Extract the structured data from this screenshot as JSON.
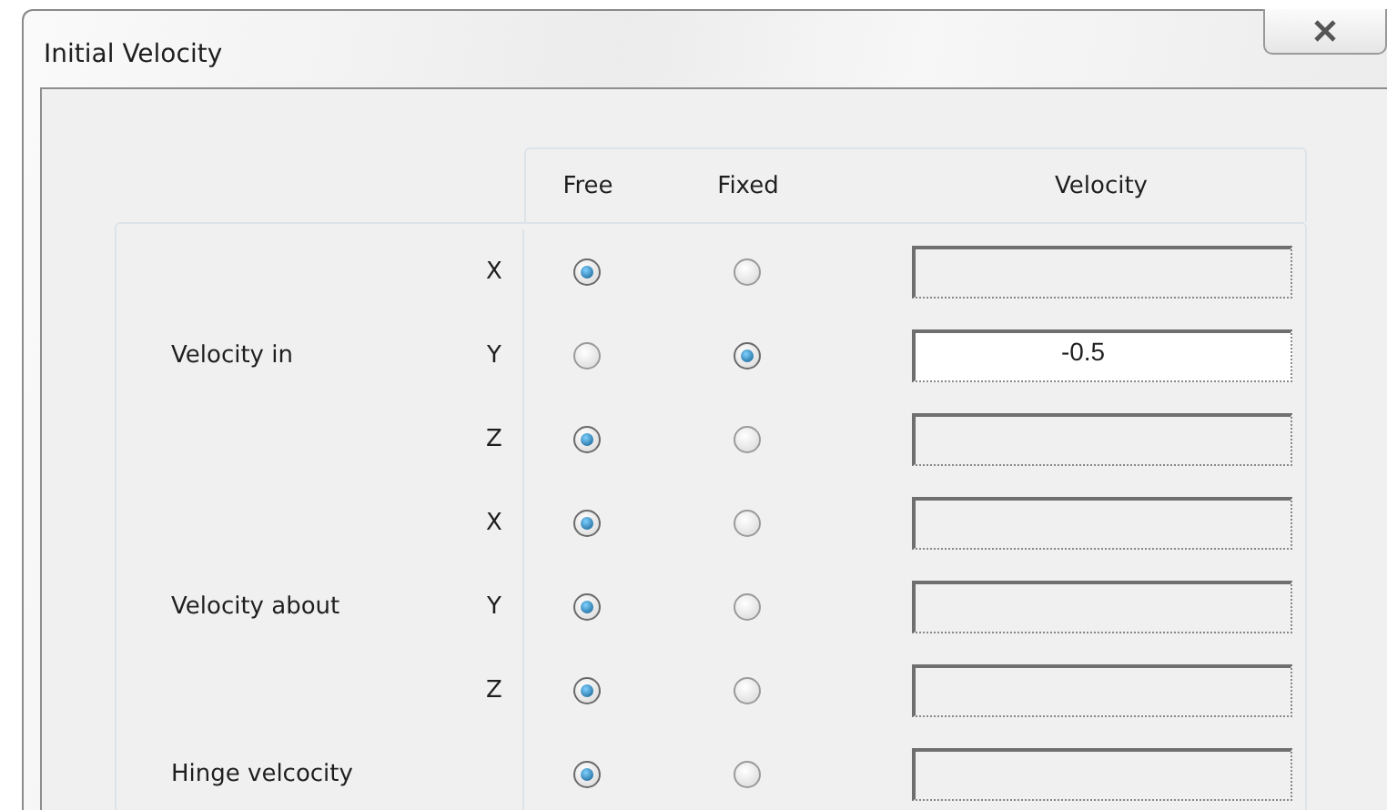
{
  "window": {
    "title": "Initial Velocity"
  },
  "columns": [
    "Free",
    "Fixed",
    "Velocity"
  ],
  "groups": [
    {
      "label": "Velocity in",
      "rows": [
        {
          "axis": "X",
          "radios": [
            {
              "selected": true
            },
            {
              "selected": false
            }
          ],
          "field": {
            "disabled": true
          }
        },
        {
          "axis": "Y",
          "radios": [
            {
              "selected": false
            },
            {
              "selected": true
            }
          ],
          "field": {
            "disabled": false,
            "value": "-0.5"
          }
        },
        {
          "axis": "Z",
          "radios": [
            {
              "selected": true
            },
            {
              "selected": false
            }
          ],
          "field": {
            "disabled": true
          }
        }
      ]
    },
    {
      "label": "Velocity about",
      "rows": [
        {
          "axis": "X",
          "radios": [
            {
              "selected": true
            },
            {
              "selected": false
            }
          ],
          "field": {
            "disabled": true
          }
        },
        {
          "axis": "Y",
          "radios": [
            {
              "selected": true
            },
            {
              "selected": false
            }
          ],
          "field": {
            "disabled": true
          }
        },
        {
          "axis": "Z",
          "radios": [
            {
              "selected": true
            },
            {
              "selected": false
            }
          ],
          "field": {
            "disabled": true
          }
        }
      ]
    },
    {
      "label": "Hinge velcocity",
      "rows": [
        {
          "radios": [
            {
              "selected": true
            },
            {
              "selected": false
            }
          ],
          "field": {
            "disabled": true
          }
        }
      ]
    }
  ]
}
